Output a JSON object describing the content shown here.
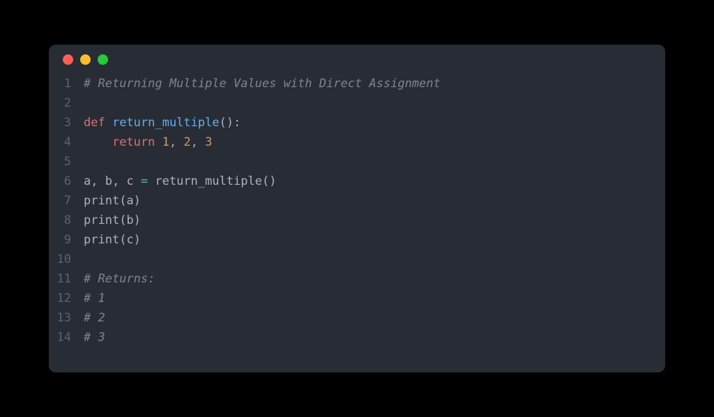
{
  "window": {
    "theme": "one-dark",
    "controls": [
      "close",
      "minimize",
      "zoom"
    ]
  },
  "code": {
    "language": "python",
    "lines": [
      {
        "n": 1,
        "tokens": [
          {
            "t": "# Returning Multiple Values with Direct Assignment",
            "c": "comment"
          }
        ]
      },
      {
        "n": 2,
        "tokens": []
      },
      {
        "n": 3,
        "tokens": [
          {
            "t": "def ",
            "c": "def"
          },
          {
            "t": "return_multiple",
            "c": "func"
          },
          {
            "t": "():",
            "c": "paren"
          }
        ]
      },
      {
        "n": 4,
        "tokens": [
          {
            "t": "    ",
            "c": "ident"
          },
          {
            "t": "return ",
            "c": "return"
          },
          {
            "t": "1",
            "c": "number"
          },
          {
            "t": ", ",
            "c": "punct"
          },
          {
            "t": "2",
            "c": "number"
          },
          {
            "t": ", ",
            "c": "punct"
          },
          {
            "t": "3",
            "c": "number"
          }
        ]
      },
      {
        "n": 5,
        "tokens": []
      },
      {
        "n": 6,
        "tokens": [
          {
            "t": "a, b, c ",
            "c": "ident"
          },
          {
            "t": "=",
            "c": "op"
          },
          {
            "t": " return_multiple()",
            "c": "ident"
          }
        ]
      },
      {
        "n": 7,
        "tokens": [
          {
            "t": "print",
            "c": "ident"
          },
          {
            "t": "(a)",
            "c": "paren"
          }
        ]
      },
      {
        "n": 8,
        "tokens": [
          {
            "t": "print",
            "c": "ident"
          },
          {
            "t": "(b)",
            "c": "paren"
          }
        ]
      },
      {
        "n": 9,
        "tokens": [
          {
            "t": "print",
            "c": "ident"
          },
          {
            "t": "(c)",
            "c": "paren"
          }
        ]
      },
      {
        "n": 10,
        "tokens": []
      },
      {
        "n": 11,
        "tokens": [
          {
            "t": "# Returns:",
            "c": "comment"
          }
        ]
      },
      {
        "n": 12,
        "tokens": [
          {
            "t": "# 1",
            "c": "comment"
          }
        ]
      },
      {
        "n": 13,
        "tokens": [
          {
            "t": "# 2",
            "c": "comment"
          }
        ]
      },
      {
        "n": 14,
        "tokens": [
          {
            "t": "# 3",
            "c": "comment"
          }
        ]
      }
    ]
  }
}
